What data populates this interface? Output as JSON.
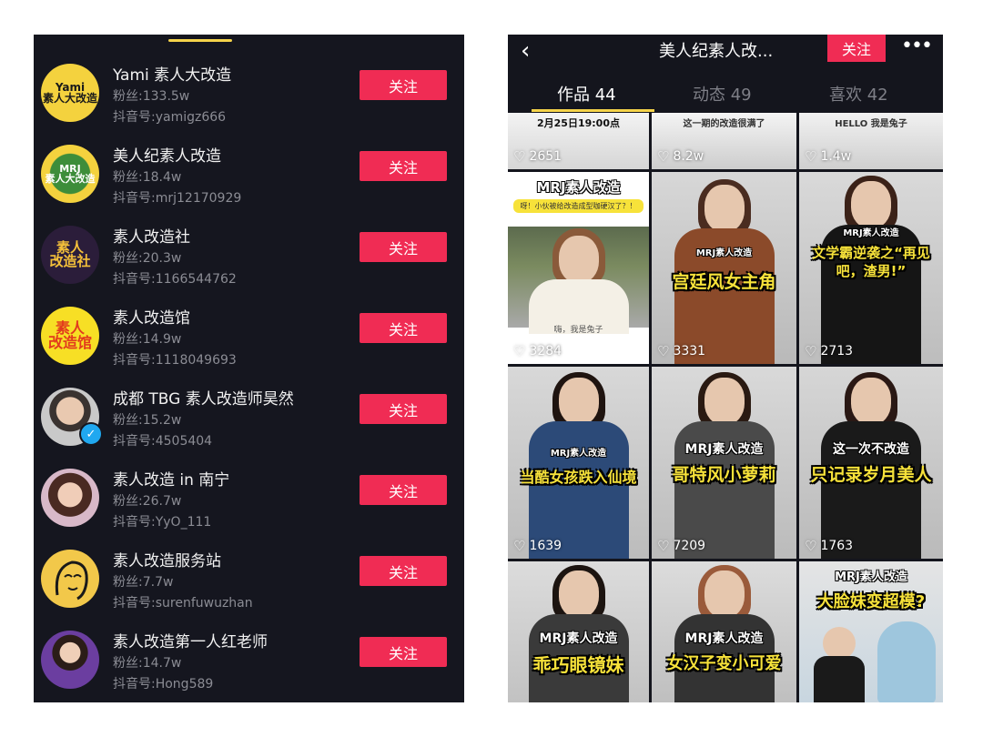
{
  "left": {
    "follow_label": "关注",
    "accounts": [
      {
        "name": "Yami 素人大改造",
        "fans": "粉丝:133.5w",
        "id": "抖音号:yamigz666",
        "avatar_text": "Yami\n素人大改造"
      },
      {
        "name": "美人纪素人改造",
        "fans": "粉丝:18.4w",
        "id": "抖音号:mrj12170929",
        "avatar_text": "MRJ\n素人大改造"
      },
      {
        "name": "素人改造社",
        "fans": "粉丝:20.3w",
        "id": "抖音号:1166544762",
        "avatar_text": "素人\n改造社"
      },
      {
        "name": "素人改造馆",
        "fans": "粉丝:14.9w",
        "id": "抖音号:1118049693",
        "avatar_text": "素人\n改造馆"
      },
      {
        "name": "成都 TBG 素人改造师昊然",
        "fans": "粉丝:15.2w",
        "id": "抖音号:4505404",
        "avatar_text": ""
      },
      {
        "name": "素人改造 in 南宁",
        "fans": "粉丝:26.7w",
        "id": "抖音号:YyO_111",
        "avatar_text": ""
      },
      {
        "name": "素人改造服务站",
        "fans": "粉丝:7.7w",
        "id": "抖音号:surenfuwuzhan",
        "avatar_text": ""
      },
      {
        "name": "素人改造第一人红老师",
        "fans": "粉丝:14.7w",
        "id": "抖音号:Hong589",
        "avatar_text": ""
      }
    ]
  },
  "right": {
    "title": "美人纪素人改...",
    "follow_label": "关注",
    "back_icon": "‹",
    "more_icon": "•••",
    "tabs": [
      {
        "label": "作品 44"
      },
      {
        "label": "动态 49"
      },
      {
        "label": "喜欢 42"
      }
    ],
    "videos": [
      {
        "likes": "2651",
        "top": "2月25日19:00点",
        "caption": "",
        "label": ""
      },
      {
        "likes": "8.2w",
        "top": "这一期的改造很满了",
        "caption": "",
        "label": ""
      },
      {
        "likes": "1.4w",
        "top": "HELLO 我是兔子",
        "caption": "",
        "label": ""
      },
      {
        "likes": "3284",
        "top": "",
        "caption": "MRJ素人改造",
        "label": "呀！小伙被给改造成型咖硬汉了？！",
        "bottom": "嗨，我是兔子"
      },
      {
        "likes": "3331",
        "top": "",
        "caption": "宫廷风女主角",
        "label": "MRJ素人改造"
      },
      {
        "likes": "2713",
        "top": "",
        "caption": "文学霸逆袭之“再见吧，渣男!”",
        "label": "MRJ素人改造"
      },
      {
        "likes": "1639",
        "top": "",
        "caption": "当酷女孩跌入仙境",
        "label": "MRJ素人改造"
      },
      {
        "likes": "7209",
        "top": "",
        "caption": "哥特风小萝莉",
        "label": "MRJ素人改造"
      },
      {
        "likes": "1763",
        "top": "",
        "caption": "只记录岁月美人",
        "label": "这一次不改造"
      },
      {
        "likes": "",
        "top": "",
        "caption": "乖巧眼镜妹",
        "label": "MRJ素人改造"
      },
      {
        "likes": "",
        "top": "",
        "caption": "女汉子变小可爱",
        "label": "MRJ素人改造"
      },
      {
        "likes": "",
        "top": "",
        "caption": "大脸妹变超模?",
        "label": "MRJ素人改造"
      }
    ]
  },
  "colors": {
    "accent": "#f02c54",
    "tab_underline": "#f5d34a",
    "panel_bg": "#15161f"
  }
}
